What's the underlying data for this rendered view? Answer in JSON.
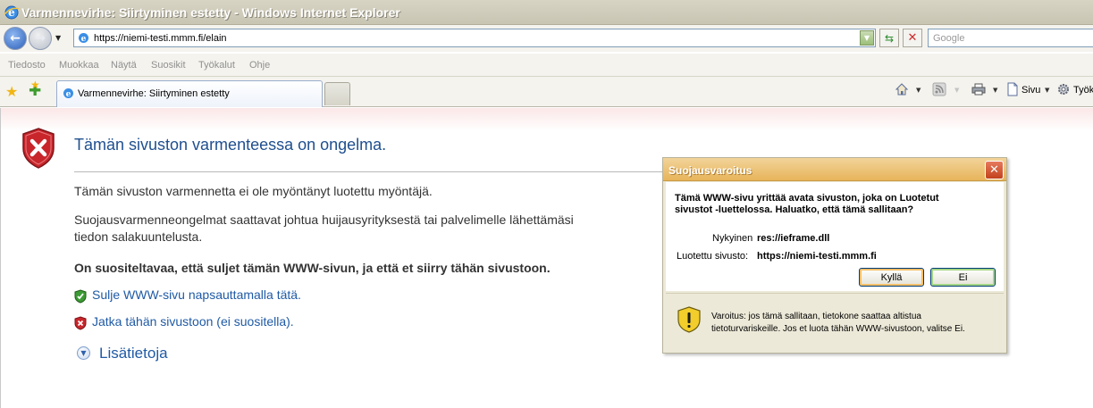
{
  "window": {
    "title": "Varmennevirhe: Siirtyminen estetty - Windows Internet Explorer"
  },
  "address_bar": {
    "url": "https://niemi-testi.mmm.fi/elain"
  },
  "search": {
    "placeholder": "Google"
  },
  "menu": {
    "items": [
      "Tiedosto",
      "Muokkaa",
      "Näytä",
      "Suosikit",
      "Työkalut",
      "Ohje"
    ]
  },
  "tabs": {
    "active_label": "Varmennevirhe: Siirtyminen estetty"
  },
  "command_bar": {
    "page_label": "Sivu",
    "tools_label": "Työk"
  },
  "error_page": {
    "heading": "Tämän sivuston varmenteessa on ongelma.",
    "para1": "Tämän sivuston varmennetta ei ole myöntänyt luotettu myöntäjä.",
    "para2_line1": "Suojausvarmenneongelmat saattavat johtua huijausyrityksestä tai palvelimelle lähettämäsi",
    "para2_line2": "tiedon salakuuntelusta.",
    "recommendation": "On suositeltavaa, että suljet tämän WWW-sivun, ja että et siirry tähän sivustoon.",
    "close_link": "Sulje WWW-sivu napsauttamalla tätä.",
    "continue_link": "Jatka tähän sivustoon (ei suositella).",
    "more_info": "Lisätietoja"
  },
  "dialog": {
    "title": "Suojausvaroitus",
    "question_line1": "Tämä WWW-sivu yrittää avata sivuston, joka on Luotetut",
    "question_line2": "sivustot -luettelossa. Haluatko, että tämä sallitaan?",
    "current_label": "Nykyinen",
    "current_value": "res://ieframe.dll",
    "trusted_label": "Luotettu sivusto:",
    "trusted_value": "https://niemi-testi.mmm.fi",
    "yes_button": "Kyllä",
    "no_button": "Ei",
    "warning_line1": "Varoitus: jos tämä sallitaan, tietokone saattaa altistua",
    "warning_line2": "tietoturvariskeille. Jos et luota tähän WWW-sivustoon, valitse Ei."
  },
  "colors": {
    "link_blue": "#1f5aa5",
    "heading_blue": "#1f4f8f",
    "error_red": "#c8262b",
    "dialog_title": "#e7b45a"
  },
  "icons": {
    "ie_logo": "ie-logo-icon",
    "error_shield": "error-shield-icon",
    "green_shield": "green-shield-icon",
    "red_shield": "red-shield-icon",
    "warning_shield": "warning-shield-icon"
  }
}
